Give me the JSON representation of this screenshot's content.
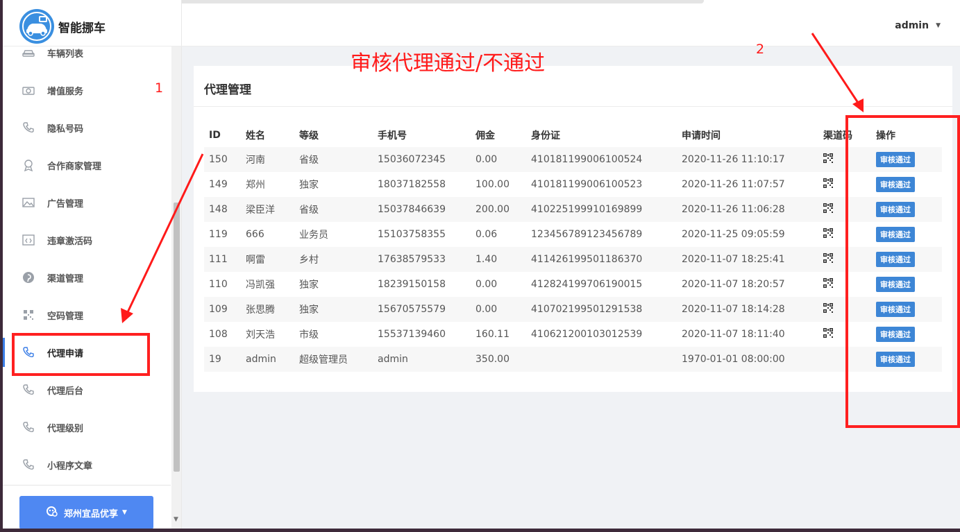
{
  "app": {
    "name": "智能挪车"
  },
  "header": {
    "user": "admin"
  },
  "sidebar": {
    "items": [
      {
        "label": "车辆列表",
        "icon": "car-icon"
      },
      {
        "label": "增值服务",
        "icon": "camera-icon"
      },
      {
        "label": "隐私号码",
        "icon": "phone-icon"
      },
      {
        "label": "合作商家管理",
        "icon": "award-icon"
      },
      {
        "label": "广告管理",
        "icon": "image-icon"
      },
      {
        "label": "违章激活码",
        "icon": "code-icon"
      },
      {
        "label": "渠道管理",
        "icon": "pinterest-icon"
      },
      {
        "label": "空码管理",
        "icon": "qrcode-icon"
      },
      {
        "label": "代理申请",
        "icon": "phone-icon",
        "active": true
      },
      {
        "label": "代理后台",
        "icon": "phone-icon"
      },
      {
        "label": "代理级别",
        "icon": "phone-icon"
      },
      {
        "label": "小程序文章",
        "icon": "phone-icon"
      }
    ],
    "store_button": "郑州宜品优享"
  },
  "panel": {
    "title": "代理管理",
    "columns": [
      "ID",
      "姓名",
      "等级",
      "手机号",
      "佣金",
      "身份证",
      "申请时间",
      "渠道码",
      "操作"
    ],
    "action_label": "审核通过",
    "rows": [
      {
        "id": "150",
        "name": "河南",
        "level": "省级",
        "phone": "15036072345",
        "commission": "0.00",
        "idcard": "410181199006100524",
        "time": "2020-11-26 11:10:17",
        "qr": true
      },
      {
        "id": "149",
        "name": "郑州",
        "level": "独家",
        "phone": "18037182558",
        "commission": "100.00",
        "idcard": "410181199006100523",
        "time": "2020-11-26 11:07:57",
        "qr": true
      },
      {
        "id": "148",
        "name": "梁臣洋",
        "level": "省级",
        "phone": "15037846639",
        "commission": "200.00",
        "idcard": "410225199910169899",
        "time": "2020-11-26 11:06:28",
        "qr": true
      },
      {
        "id": "119",
        "name": "666",
        "level": "业务员",
        "phone": "15103758355",
        "commission": "0.06",
        "idcard": "123456789123456789",
        "time": "2020-11-25 09:05:59",
        "qr": true
      },
      {
        "id": "111",
        "name": "啊雷",
        "level": "乡村",
        "phone": "17638579533",
        "commission": "1.40",
        "idcard": "411426199501186370",
        "time": "2020-11-07 18:25:41",
        "qr": true
      },
      {
        "id": "110",
        "name": "冯凯强",
        "level": "独家",
        "phone": "18239150158",
        "commission": "0.00",
        "idcard": "412824199706190015",
        "time": "2020-11-07 18:20:57",
        "qr": true
      },
      {
        "id": "109",
        "name": "张思腾",
        "level": "独家",
        "phone": "15670575579",
        "commission": "0.00",
        "idcard": "410702199501291538",
        "time": "2020-11-07 18:14:28",
        "qr": true
      },
      {
        "id": "108",
        "name": "刘天浩",
        "level": "市级",
        "phone": "15537139460",
        "commission": "160.11",
        "idcard": "410621200103012539",
        "time": "2020-11-07 18:11:40",
        "qr": true
      },
      {
        "id": "19",
        "name": "admin",
        "level": "超级管理员",
        "phone": "admin",
        "commission": "350.00",
        "idcard": "",
        "time": "1970-01-01 08:00:00",
        "qr": false
      }
    ]
  },
  "annotations": {
    "caption": "审核代理通过/不通过",
    "marker_1": "1",
    "marker_2": "2",
    "color": "#ff1a1a"
  }
}
